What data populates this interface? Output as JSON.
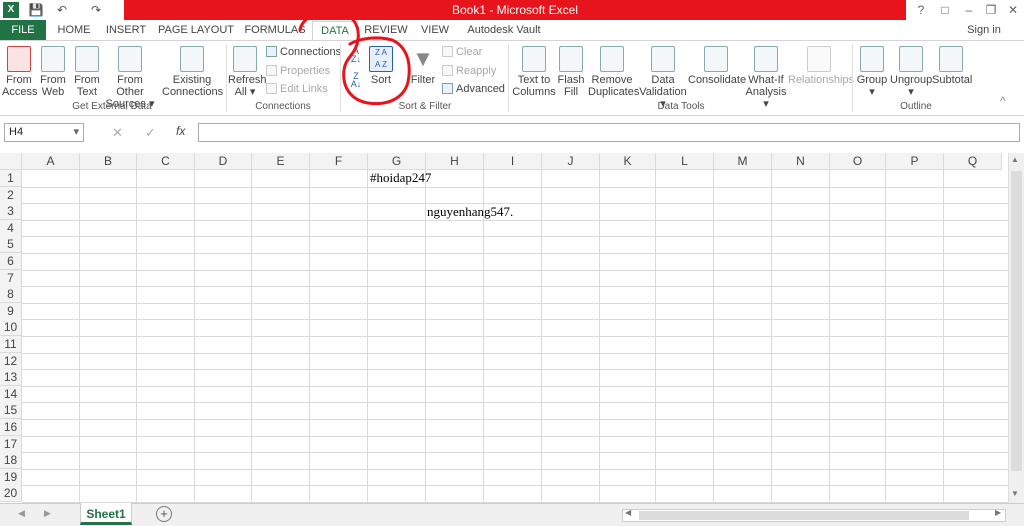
{
  "window": {
    "title": "Book1 - Microsoft Excel",
    "sign_in": "Sign in",
    "brand_color": "#217346",
    "highlight_color": "#e8141b"
  },
  "tabs": [
    "FILE",
    "HOME",
    "INSERT",
    "PAGE LAYOUT",
    "FORMULAS",
    "DATA",
    "REVIEW",
    "VIEW",
    "Autodesk Vault"
  ],
  "active_tab": "DATA",
  "ribbon": {
    "get_external_data": {
      "group_name": "Get External Data",
      "from_access": [
        "From",
        "Access"
      ],
      "from_web": [
        "From",
        "Web"
      ],
      "from_text": [
        "From",
        "Text"
      ],
      "from_other": [
        "From Other",
        "Sources"
      ],
      "existing": [
        "Existing",
        "Connections"
      ]
    },
    "connections": {
      "group_name": "Connections",
      "refresh_all": [
        "Refresh",
        "All"
      ],
      "connections": "Connections",
      "properties": "Properties",
      "edit_links": "Edit Links"
    },
    "sort_filter": {
      "group_name": "Sort & Filter",
      "sort": "Sort",
      "filter": "Filter",
      "clear": "Clear",
      "reapply": "Reapply",
      "advanced": "Advanced"
    },
    "data_tools": {
      "group_name": "Data Tools",
      "text_to_columns": [
        "Text to",
        "Columns"
      ],
      "flash_fill": [
        "Flash",
        "Fill"
      ],
      "remove_duplicates": [
        "Remove",
        "Duplicates"
      ],
      "data_validation": [
        "Data",
        "Validation"
      ],
      "consolidate": "Consolidate",
      "what_if": [
        "What-If",
        "Analysis"
      ],
      "relationships": "Relationships"
    },
    "outline": {
      "group_name": "Outline",
      "group": "Group",
      "ungroup": "Ungroup",
      "subtotal": "Subtotal"
    }
  },
  "formula_bar": {
    "name_box": "H4",
    "fx": "fx",
    "value": ""
  },
  "grid": {
    "columns": [
      "A",
      "B",
      "C",
      "D",
      "E",
      "F",
      "G",
      "H",
      "I",
      "J",
      "K",
      "L",
      "M",
      "N",
      "O",
      "P",
      "Q"
    ],
    "rows": [
      "1",
      "2",
      "3",
      "4",
      "5",
      "6",
      "7",
      "8",
      "9",
      "10",
      "11",
      "12",
      "13",
      "14",
      "15",
      "16",
      "17",
      "18",
      "19",
      "20"
    ],
    "cells": {
      "G1": "#hoidap247",
      "H3": "nguyenhang547."
    }
  },
  "sheets": [
    "Sheet1"
  ],
  "icons": [
    "excel-logo-icon",
    "save-icon",
    "undo-icon",
    "redo-icon",
    "sort-az-icon",
    "sort-za-icon",
    "filter-icon",
    "add-sheet-icon"
  ]
}
